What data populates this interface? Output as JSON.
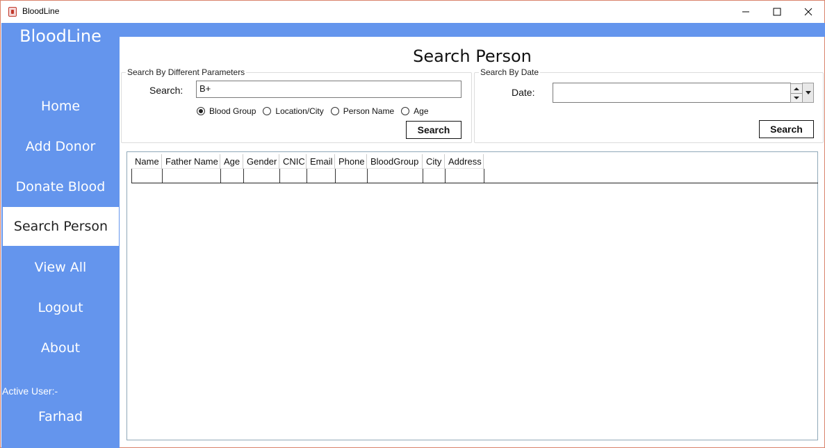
{
  "window": {
    "title": "BloodLine"
  },
  "sidebar": {
    "brand": "BloodLine",
    "items": [
      {
        "label": "Home"
      },
      {
        "label": "Add Donor"
      },
      {
        "label": "Donate Blood"
      },
      {
        "label": "Search Person",
        "active": true
      },
      {
        "label": "View All"
      },
      {
        "label": "Logout"
      },
      {
        "label": "About"
      }
    ],
    "active_user_label": "Active User:-",
    "active_user_name": "Farhad"
  },
  "main": {
    "page_title": "Search Person",
    "params_group": {
      "legend": "Search By Different Parameters",
      "search_label": "Search:",
      "search_value": "B+",
      "radios": [
        {
          "label": "Blood Group",
          "checked": true
        },
        {
          "label": "Location/City",
          "checked": false
        },
        {
          "label": "Person Name",
          "checked": false
        },
        {
          "label": "Age",
          "checked": false
        }
      ],
      "button_label": "Search"
    },
    "date_group": {
      "legend": "Search By Date",
      "date_label": "Date:",
      "date_value": "",
      "button_label": "Search"
    },
    "table": {
      "columns": [
        "Name",
        "Father Name",
        "Age",
        "Gender",
        "CNIC",
        "Email",
        "Phone",
        "BloodGroup",
        "City",
        "Address"
      ],
      "rows": []
    }
  },
  "colors": {
    "sidebar": "#6495ed",
    "active_item_bg": "#ffffff"
  }
}
